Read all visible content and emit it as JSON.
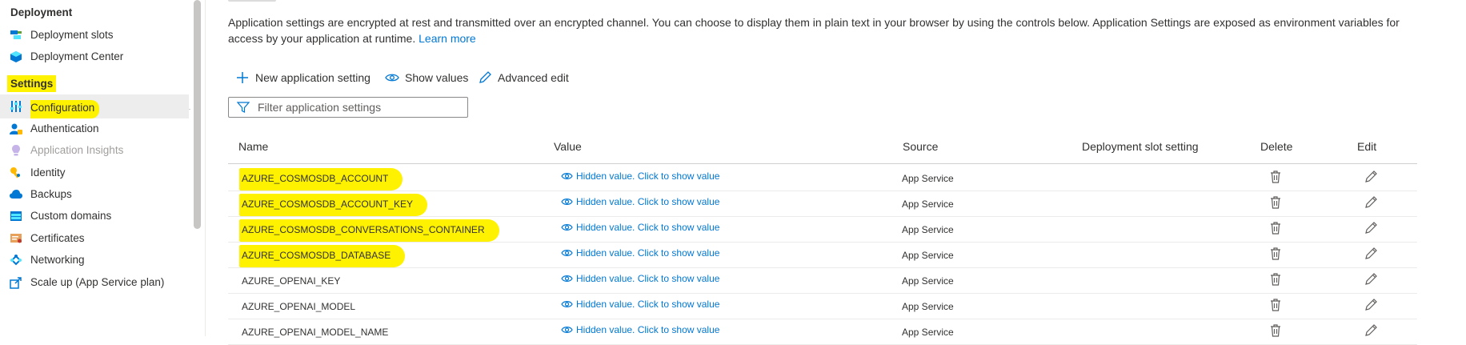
{
  "sidebar": {
    "deployment_heading": "Deployment",
    "settings_heading": "Settings",
    "items": [
      {
        "label": "Deployment slots",
        "icon": "deployment-slots-icon"
      },
      {
        "label": "Deployment Center",
        "icon": "deployment-center-icon"
      },
      {
        "label": "Configuration",
        "icon": "configuration-icon",
        "active": true
      },
      {
        "label": "Authentication",
        "icon": "authentication-icon"
      },
      {
        "label": "Application Insights",
        "icon": "application-insights-icon",
        "disabled": true
      },
      {
        "label": "Identity",
        "icon": "identity-icon"
      },
      {
        "label": "Backups",
        "icon": "backups-icon"
      },
      {
        "label": "Custom domains",
        "icon": "custom-domains-icon"
      },
      {
        "label": "Certificates",
        "icon": "certificates-icon"
      },
      {
        "label": "Networking",
        "icon": "networking-icon"
      },
      {
        "label": "Scale up (App Service plan)",
        "icon": "scale-up-icon"
      }
    ]
  },
  "main": {
    "description": "Application settings are encrypted at rest and transmitted over an encrypted channel. You can choose to display them in plain text in your browser by using the controls below. Application Settings are exposed as environment variables for access by your application at runtime.",
    "learn_more": "Learn more",
    "toolbar": {
      "new_setting": "New application setting",
      "show_values": "Show values",
      "advanced_edit": "Advanced edit"
    },
    "filter": {
      "placeholder": "Filter application settings"
    },
    "table": {
      "headers": {
        "name": "Name",
        "value": "Value",
        "source": "Source",
        "slot_setting": "Deployment slot setting",
        "delete": "Delete",
        "edit": "Edit"
      },
      "rows": [
        {
          "name": "AZURE_COSMOSDB_ACCOUNT",
          "value": "Hidden value. Click to show value",
          "source": "App Service",
          "highlighted": true
        },
        {
          "name": "AZURE_COSMOSDB_ACCOUNT_KEY",
          "value": "Hidden value. Click to show value",
          "source": "App Service",
          "highlighted": true
        },
        {
          "name": "AZURE_COSMOSDB_CONVERSATIONS_CONTAINER",
          "value": "Hidden value. Click to show value",
          "source": "App Service",
          "highlighted": true
        },
        {
          "name": "AZURE_COSMOSDB_DATABASE",
          "value": "Hidden value. Click to show value",
          "source": "App Service",
          "highlighted": true
        },
        {
          "name": "AZURE_OPENAI_KEY",
          "value": "Hidden value. Click to show value",
          "source": "App Service"
        },
        {
          "name": "AZURE_OPENAI_MODEL",
          "value": "Hidden value. Click to show value",
          "source": "App Service"
        },
        {
          "name": "AZURE_OPENAI_MODEL_NAME",
          "value": "Hidden value. Click to show value",
          "source": "App Service"
        }
      ]
    }
  },
  "colors": {
    "accent": "#0078d4",
    "highlight": "#fff200",
    "active_nav_bg": "#ededed"
  }
}
